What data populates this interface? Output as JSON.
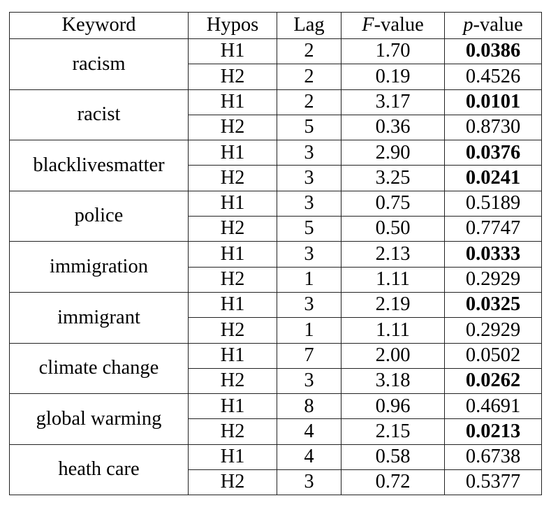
{
  "table": {
    "headers": {
      "keyword": "Keyword",
      "hypos": "Hypos",
      "lag": "Lag",
      "f_italic": "F",
      "f_rest": "-value",
      "p_italic": "p",
      "p_rest": "-value"
    },
    "groups": [
      {
        "keyword": "racism",
        "rows": [
          {
            "hypo": "H1",
            "lag": "2",
            "f": "1.70",
            "p": "0.0386",
            "significant": true
          },
          {
            "hypo": "H2",
            "lag": "2",
            "f": "0.19",
            "p": "0.4526",
            "significant": false
          }
        ]
      },
      {
        "keyword": "racist",
        "rows": [
          {
            "hypo": "H1",
            "lag": "2",
            "f": "3.17",
            "p": "0.0101",
            "significant": true
          },
          {
            "hypo": "H2",
            "lag": "5",
            "f": "0.36",
            "p": "0.8730",
            "significant": false
          }
        ]
      },
      {
        "keyword": "blacklivesmatter",
        "rows": [
          {
            "hypo": "H1",
            "lag": "3",
            "f": "2.90",
            "p": "0.0376",
            "significant": true
          },
          {
            "hypo": "H2",
            "lag": "3",
            "f": "3.25",
            "p": "0.0241",
            "significant": true
          }
        ]
      },
      {
        "keyword": "police",
        "rows": [
          {
            "hypo": "H1",
            "lag": "3",
            "f": "0.75",
            "p": "0.5189",
            "significant": false
          },
          {
            "hypo": "H2",
            "lag": "5",
            "f": "0.50",
            "p": "0.7747",
            "significant": false
          }
        ]
      },
      {
        "keyword": "immigration",
        "rows": [
          {
            "hypo": "H1",
            "lag": "3",
            "f": "2.13",
            "p": "0.0333",
            "significant": true
          },
          {
            "hypo": "H2",
            "lag": "1",
            "f": "1.11",
            "p": "0.2929",
            "significant": false
          }
        ]
      },
      {
        "keyword": "immigrant",
        "rows": [
          {
            "hypo": "H1",
            "lag": "3",
            "f": "2.19",
            "p": "0.0325",
            "significant": true
          },
          {
            "hypo": "H2",
            "lag": "1",
            "f": "1.11",
            "p": "0.2929",
            "significant": false
          }
        ]
      },
      {
        "keyword": "climate change",
        "rows": [
          {
            "hypo": "H1",
            "lag": "7",
            "f": "2.00",
            "p": "0.0502",
            "significant": false
          },
          {
            "hypo": "H2",
            "lag": "3",
            "f": "3.18",
            "p": "0.0262",
            "significant": true
          }
        ]
      },
      {
        "keyword": "global warming",
        "rows": [
          {
            "hypo": "H1",
            "lag": "8",
            "f": "0.96",
            "p": "0.4691",
            "significant": false
          },
          {
            "hypo": "H2",
            "lag": "4",
            "f": "2.15",
            "p": "0.0213",
            "significant": true
          }
        ]
      },
      {
        "keyword": "heath care",
        "rows": [
          {
            "hypo": "H1",
            "lag": "4",
            "f": "0.58",
            "p": "0.6738",
            "significant": false
          },
          {
            "hypo": "H2",
            "lag": "3",
            "f": "0.72",
            "p": "0.5377",
            "significant": false
          }
        ]
      }
    ]
  }
}
